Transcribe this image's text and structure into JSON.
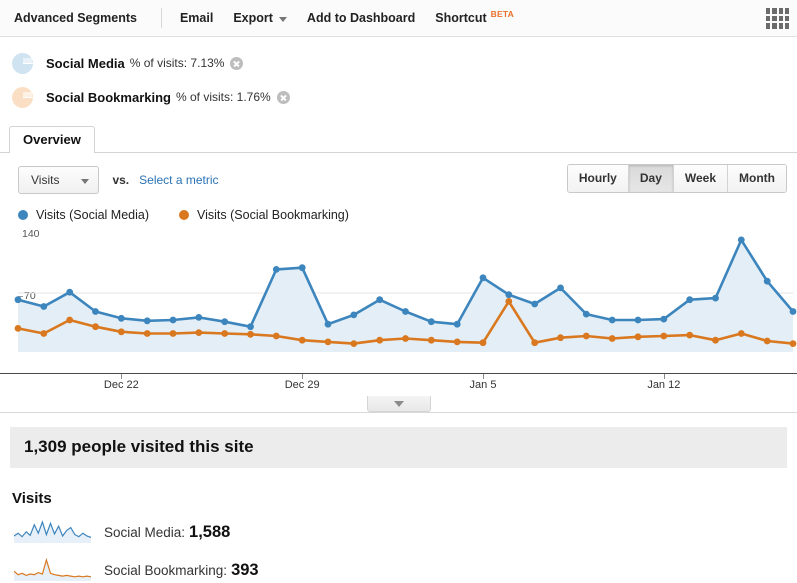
{
  "toolbar": {
    "advanced_segments": "Advanced Segments",
    "email": "Email",
    "export": "Export",
    "add_to_dashboard": "Add to Dashboard",
    "shortcut": "Shortcut",
    "beta": "BETA",
    "grid_icon": "grid-icon"
  },
  "segments": [
    {
      "name": "Social Media",
      "metric": "% of visits: 7.13%",
      "color": "#cfe3f1",
      "close_icon": "close-icon"
    },
    {
      "name": "Social Bookmarking",
      "metric": "% of visits: 1.76%",
      "color": "#fadfc5",
      "close_icon": "close-icon"
    }
  ],
  "tabs": [
    {
      "label": "Overview",
      "active": true
    }
  ],
  "controls": {
    "metric_select": "Visits",
    "metric_caret_icon": "chevron-down-icon",
    "vs_label": "vs.",
    "select_metric_link": "Select a metric",
    "granularity": [
      {
        "label": "Hourly",
        "active": false
      },
      {
        "label": "Day",
        "active": true
      },
      {
        "label": "Week",
        "active": false
      },
      {
        "label": "Month",
        "active": false
      }
    ]
  },
  "legend": [
    {
      "label": "Visits (Social Media)",
      "color": "#3d85bd"
    },
    {
      "label": "Visits (Social Bookmarking)",
      "color": "#d9781f"
    }
  ],
  "summary": {
    "headline": "1,309 people visited this site",
    "section_title": "Visits",
    "rows": [
      {
        "label": "Social Media:",
        "value": "1,588",
        "color": "#3d85bd"
      },
      {
        "label": "Social Bookmarking:",
        "value": "393",
        "color": "#d9781f"
      }
    ]
  },
  "collapse_handle_icon": "chevron-down-icon",
  "chart_data": {
    "type": "line",
    "title": "",
    "xlabel": "",
    "ylabel": "",
    "ylim": [
      0,
      140
    ],
    "yticks": [
      70,
      140
    ],
    "ytick_labels": [
      "70",
      "140"
    ],
    "grid": true,
    "legend_position": "top-left",
    "area_fill": true,
    "area_fill_color": "#e3eef7",
    "x_tick_labels": [
      "Dec 22",
      "Dec 29",
      "Jan 5",
      "Jan 12"
    ],
    "x_tick_indices": [
      4,
      11,
      18,
      25
    ],
    "x": [
      "Dec 18",
      "Dec 19",
      "Dec 20",
      "Dec 21",
      "Dec 22",
      "Dec 23",
      "Dec 24",
      "Dec 25",
      "Dec 26",
      "Dec 27",
      "Dec 28",
      "Dec 29",
      "Dec 30",
      "Dec 31",
      "Jan 1",
      "Jan 2",
      "Jan 3",
      "Jan 4",
      "Jan 5",
      "Jan 6",
      "Jan 7",
      "Jan 8",
      "Jan 9",
      "Jan 10",
      "Jan 11",
      "Jan 12",
      "Jan 13",
      "Jan 14",
      "Jan 15",
      "Jan 16",
      "Jan 17"
    ],
    "series": [
      {
        "name": "Visits (Social Media)",
        "color": "#3d85bd",
        "values": [
          62,
          54,
          71,
          48,
          40,
          37,
          38,
          41,
          36,
          30,
          98,
          100,
          33,
          44,
          62,
          48,
          36,
          33,
          88,
          68,
          57,
          76,
          45,
          38,
          38,
          39,
          62,
          64,
          133,
          84,
          48
        ]
      },
      {
        "name": "Visits (Social Bookmarking)",
        "color": "#d9781f",
        "values": [
          28,
          22,
          38,
          30,
          24,
          22,
          22,
          23,
          22,
          21,
          19,
          14,
          12,
          10,
          14,
          16,
          14,
          12,
          11,
          60,
          11,
          17,
          19,
          16,
          18,
          19,
          20,
          14,
          22,
          13,
          10
        ]
      }
    ]
  },
  "sparklines": [
    {
      "name": "Social Media",
      "color": "#3d85bd",
      "values": [
        10,
        14,
        9,
        16,
        11,
        26,
        14,
        30,
        12,
        28,
        13,
        24,
        10,
        18,
        22,
        12,
        9,
        14,
        10,
        8
      ]
    },
    {
      "name": "Social Bookmarking",
      "color": "#d9781f",
      "values": [
        14,
        9,
        11,
        8,
        10,
        9,
        12,
        10,
        30,
        11,
        9,
        8,
        7,
        8,
        7,
        6,
        7,
        6,
        7,
        6
      ]
    }
  ]
}
